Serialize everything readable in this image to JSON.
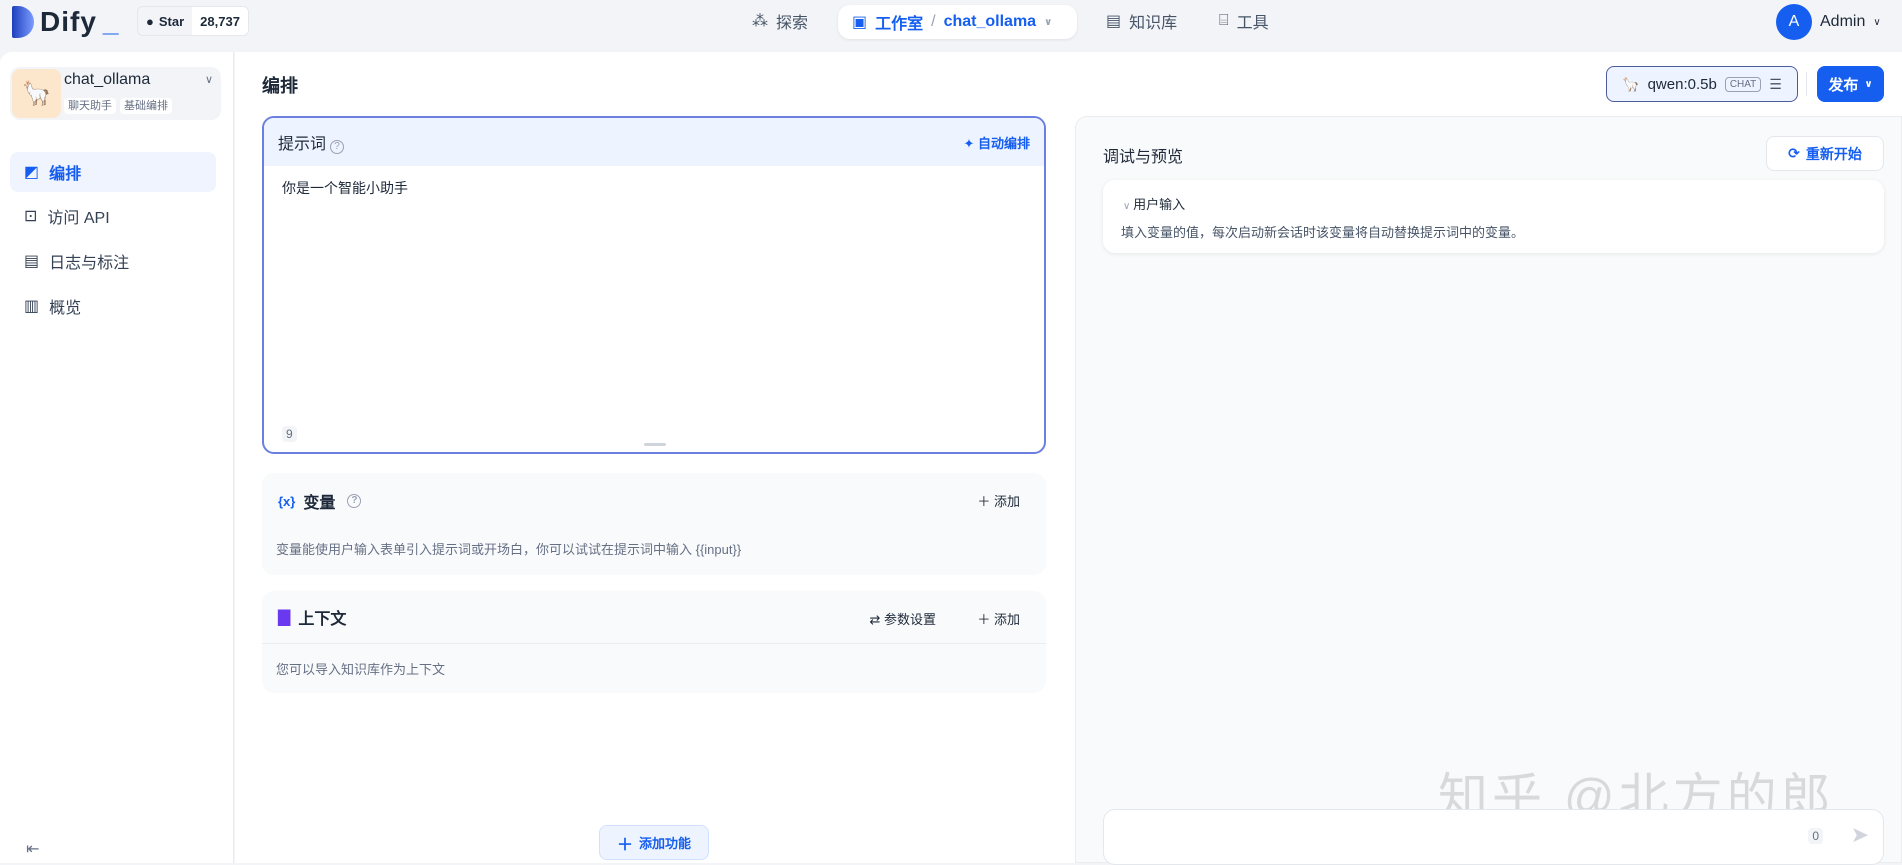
{
  "header": {
    "logo": "Dify",
    "github_star": "Star",
    "star_count": "28,737",
    "nav": {
      "explore": "探索",
      "studio": "工作室",
      "app": "chat_ollama",
      "knowledge": "知识库",
      "tools": "工具"
    },
    "user_initial": "A",
    "user": "Admin"
  },
  "sidebar": {
    "app_name": "chat_ollama",
    "tags": [
      "聊天助手",
      "基础编排"
    ],
    "items": [
      {
        "label": "编排",
        "icon": "orchestrate-icon"
      },
      {
        "label": "访问 API",
        "icon": "terminal-icon"
      },
      {
        "label": "日志与标注",
        "icon": "log-icon"
      },
      {
        "label": "概览",
        "icon": "chart-icon"
      }
    ]
  },
  "main": {
    "title": "编排",
    "model": "qwen:0.5b",
    "model_badge": "CHAT",
    "publish": "发布",
    "prompt": {
      "title": "提示词",
      "auto": "自动编排",
      "text": "你是一个智能小助手",
      "count": "9"
    },
    "variables": {
      "title": "变量",
      "add": "添加",
      "desc": "变量能使用户输入表单引入提示词或开场白，你可以试试在提示词中输入 {{input}}"
    },
    "context": {
      "title": "上下文",
      "params": "参数设置",
      "add": "添加",
      "desc": "您可以导入知识库作为上下文"
    },
    "add_feature": "添加功能"
  },
  "preview": {
    "title": "调试与预览",
    "restart": "重新开始",
    "user_input": "用户输入",
    "user_input_desc": "填入变量的值，每次启动新会话时该变量将自动替换提示词中的变量。",
    "char_count": "0"
  },
  "watermark": "知乎 @北方的郎",
  "colors": {
    "accent": "#155eef"
  }
}
